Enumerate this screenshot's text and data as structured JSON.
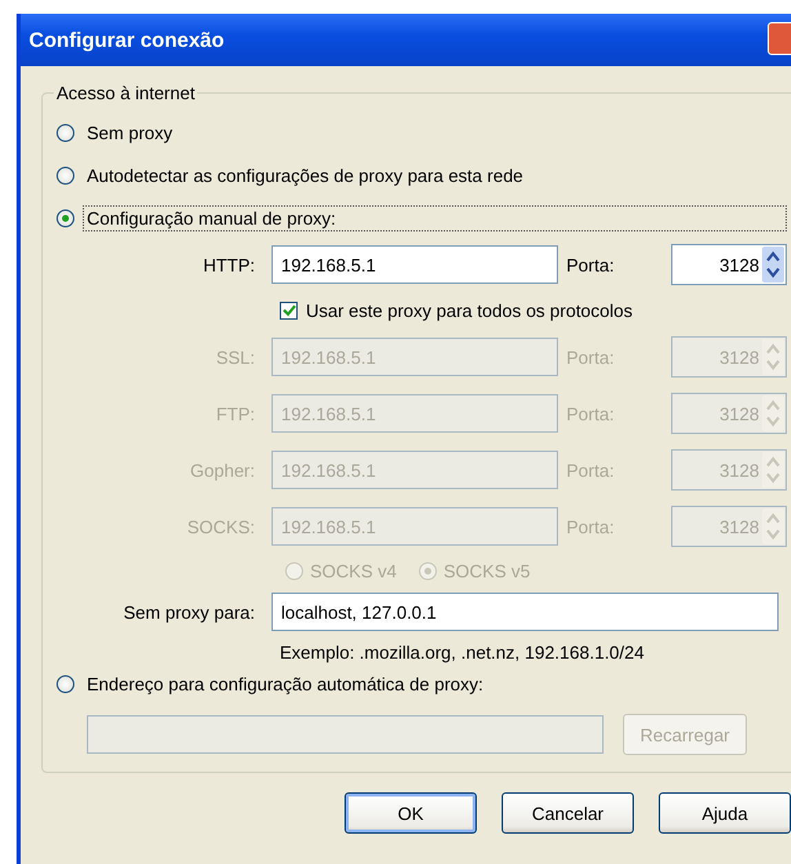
{
  "window": {
    "title": "Configurar conexão"
  },
  "group": {
    "legend": "Acesso à internet"
  },
  "modes": [
    {
      "label": "Sem proxy",
      "selected": false,
      "focused": false
    },
    {
      "label": "Autodetectar as configurações de proxy para esta rede",
      "selected": false,
      "focused": false
    },
    {
      "label": "Configuração manual de proxy:",
      "selected": true,
      "focused": true
    },
    {
      "label": "Endereço para configuração automática de proxy:",
      "selected": false,
      "focused": false
    }
  ],
  "proxies": [
    {
      "label": "HTTP:",
      "value": "192.168.5.1",
      "port_label": "Porta:",
      "port": "3128",
      "disabled": false
    },
    {
      "label": "SSL:",
      "value": "192.168.5.1",
      "port_label": "Porta:",
      "port": "3128",
      "disabled": true
    },
    {
      "label": "FTP:",
      "value": "192.168.5.1",
      "port_label": "Porta:",
      "port": "3128",
      "disabled": true
    },
    {
      "label": "Gopher:",
      "value": "192.168.5.1",
      "port_label": "Porta:",
      "port": "3128",
      "disabled": true
    },
    {
      "label": "SOCKS:",
      "value": "192.168.5.1",
      "port_label": "Porta:",
      "port": "3128",
      "disabled": true
    }
  ],
  "share_all": {
    "label": "Usar este proxy para todos os protocolos",
    "checked": true
  },
  "socks_versions": [
    {
      "label": "SOCKS v4",
      "selected": false,
      "disabled": true
    },
    {
      "label": "SOCKS v5",
      "selected": true,
      "disabled": true
    }
  ],
  "no_proxy": {
    "label": "Sem proxy para:",
    "value": "localhost, 127.0.0.1"
  },
  "example": "Exemplo: .mozilla.org, .net.nz, 192.168.1.0/24",
  "auto_url": {
    "disabled": true
  },
  "reload_button": {
    "label": "Recarregar",
    "disabled": true
  },
  "buttons": [
    {
      "label": "OK",
      "default": true
    },
    {
      "label": "Cancelar",
      "default": false
    },
    {
      "label": "Ajuda",
      "default": false
    }
  ]
}
